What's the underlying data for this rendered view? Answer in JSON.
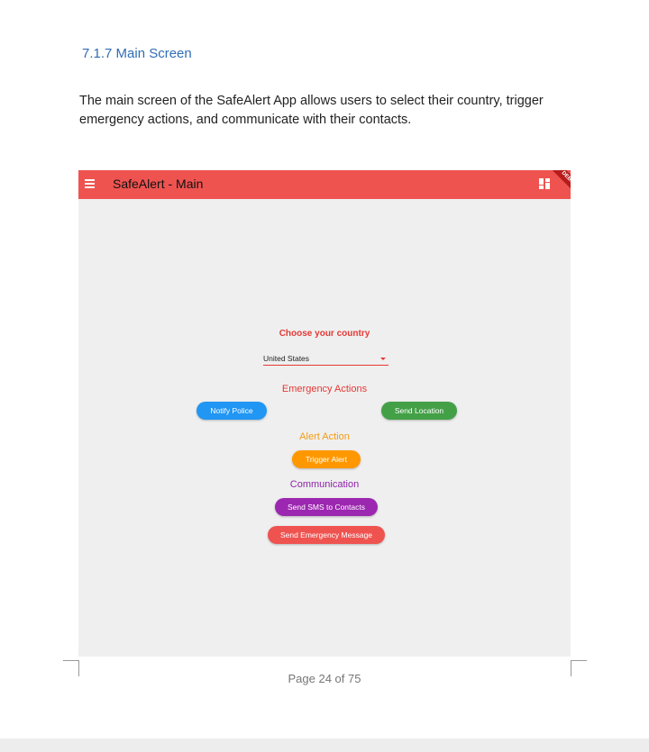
{
  "document": {
    "heading": "7.1.7 Main Screen",
    "intro_line1": "The main screen of the SafeAlert App allows users to select their country, trigger",
    "intro_line2": "emergency actions, and communicate with their contacts.",
    "page_number": "Page 24 of 75"
  },
  "app": {
    "title": "SafeAlert - Main",
    "debug_label": "DEBUG",
    "menu_icon": "hamburger-menu-icon",
    "dashboard_icon": "dashboard-grid-icon",
    "colors": {
      "appbar": "#ef5350",
      "background": "#efefef",
      "police": "#2196f3",
      "location": "#43a047",
      "alert": "#ff9800",
      "sms": "#9c27b0",
      "message": "#ef5350"
    },
    "country": {
      "label": "Choose your country",
      "selected": "United States"
    },
    "emergency": {
      "heading": "Emergency Actions",
      "notify_police": "Notify Police",
      "send_location": "Send Location"
    },
    "alert": {
      "heading": "Alert Action",
      "trigger": "Trigger Alert"
    },
    "communication": {
      "heading": "Communication",
      "send_sms": "Send SMS to Contacts",
      "send_message": "Send Emergency Message"
    }
  }
}
